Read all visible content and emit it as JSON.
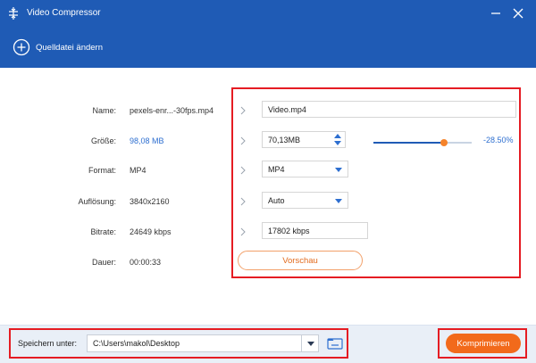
{
  "window": {
    "title": "Video Compressor"
  },
  "toolbar": {
    "change_source_label": "Quelldatei ändern"
  },
  "source": {
    "name_label": "Name:",
    "name_value": "pexels-enr...-30fps.mp4",
    "size_label": "Größe:",
    "size_value": "98,08 MB",
    "format_label": "Format:",
    "format_value": "MP4",
    "resolution_label": "Auflösung:",
    "resolution_value": "3840x2160",
    "bitrate_label": "Bitrate:",
    "bitrate_value": "24649 kbps",
    "duration_label": "Dauer:",
    "duration_value": "00:00:33"
  },
  "output": {
    "name": "Video.mp4",
    "size": "70,13MB",
    "size_fraction": 0.715,
    "percent": "-28.50%",
    "format": "MP4",
    "resolution": "Auto",
    "bitrate": "17802 kbps",
    "preview_label": "Vorschau"
  },
  "footer": {
    "save_label": "Speichern unter:",
    "save_path": "C:\\Users\\makol\\Desktop",
    "compress_label": "Komprimieren"
  },
  "colors": {
    "brand": "#1f5bb5",
    "accent": "#f26a1b",
    "highlight": "#e51c23"
  }
}
